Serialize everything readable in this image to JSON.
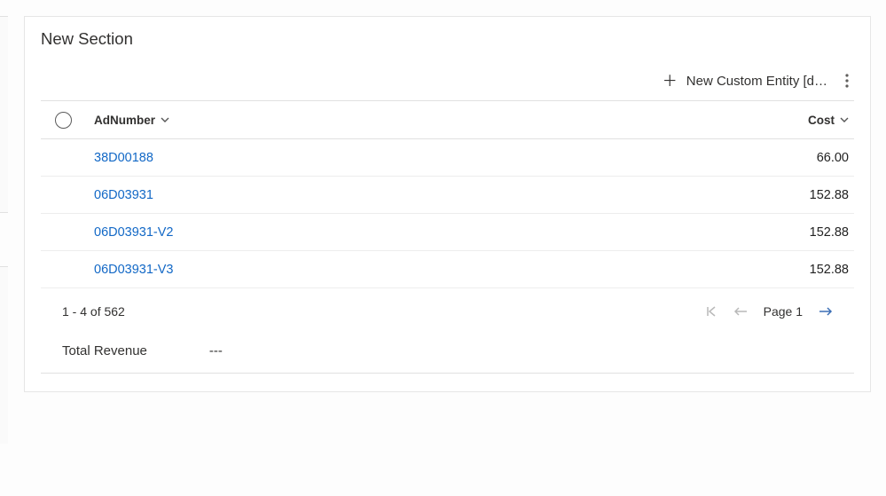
{
  "section": {
    "title": "New Section"
  },
  "toolbar": {
    "new_label": "New Custom Entity [d…"
  },
  "table": {
    "headers": {
      "adnumber": "AdNumber",
      "cost": "Cost"
    },
    "rows": [
      {
        "adnumber": "38D00188",
        "cost": "66.00"
      },
      {
        "adnumber": "06D03931",
        "cost": "152.88"
      },
      {
        "adnumber": "06D03931-V2",
        "cost": "152.88"
      },
      {
        "adnumber": "06D03931-V3",
        "cost": "152.88"
      }
    ]
  },
  "pager": {
    "range": "1 - 4 of 562",
    "page_label": "Page 1"
  },
  "total": {
    "label": "Total Revenue",
    "value": "---"
  }
}
